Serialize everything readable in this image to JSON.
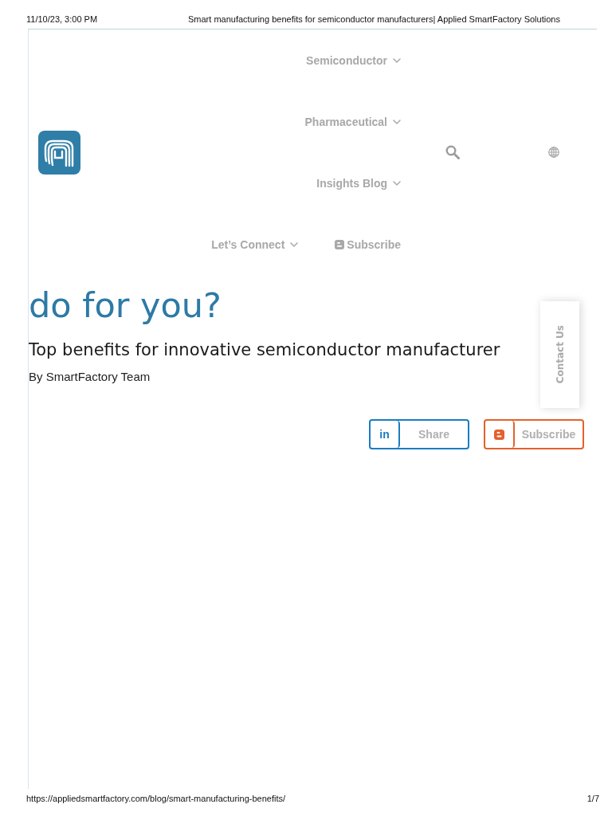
{
  "print_header": {
    "date": "11/10/23, 3:00 PM",
    "title": "Smart manufacturing benefits for semiconductor manufacturers| Applied SmartFactory Solutions"
  },
  "nav": {
    "rows": [
      {
        "items": [
          {
            "label": "Semiconductor",
            "kind": "dropdown"
          }
        ]
      },
      {
        "items": [
          {
            "label": "Pharmaceutical",
            "kind": "dropdown"
          }
        ]
      },
      {
        "items": [
          {
            "label": "Insights Blog",
            "kind": "dropdown"
          }
        ]
      },
      {
        "items": [
          {
            "label": "Let’s Connect",
            "kind": "dropdown"
          },
          {
            "label": "Subscribe",
            "kind": "blog"
          }
        ]
      }
    ]
  },
  "article": {
    "heading": "do for you?",
    "subtitle": "Top benefits for innovative semiconductor manufacturer",
    "byline": "By SmartFactory Team"
  },
  "contact_tab": {
    "label": "Contact Us"
  },
  "share_buttons": [
    {
      "kind": "linkedin",
      "icon_label": "in",
      "label": "Share",
      "color": "#1a7cc1"
    },
    {
      "kind": "blog",
      "label": "Subscribe",
      "color": "#e4612b"
    }
  ],
  "footer": {
    "url": "https://appliedsmartfactory.com/blog/smart-manufacturing-benefits/",
    "page": "1/7"
  }
}
